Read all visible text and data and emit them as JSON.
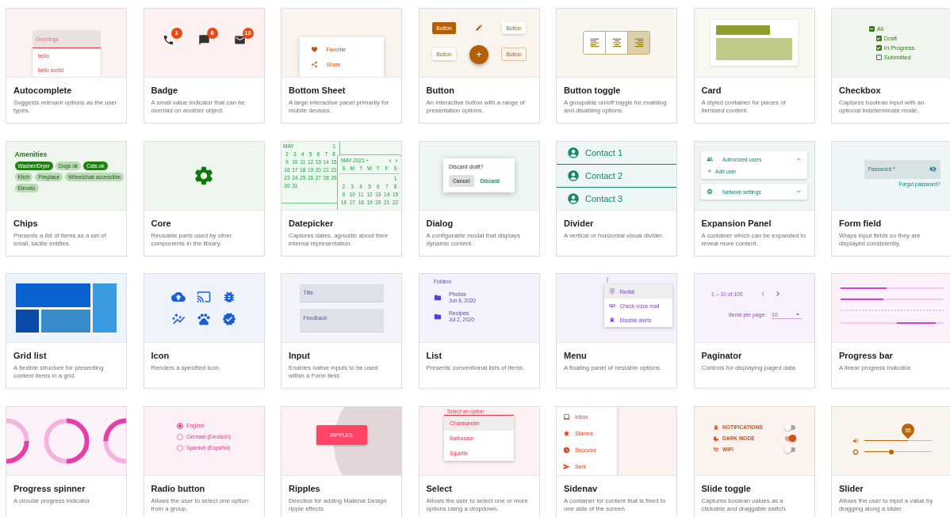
{
  "cards": [
    {
      "title": "Autocomplete",
      "description": "Suggests relevant options as the user types.",
      "preview": {
        "kind": "autocomplete",
        "placeholder": "Greetings",
        "options": [
          "hello",
          "hello world"
        ]
      }
    },
    {
      "title": "Badge",
      "description": "A small value indicator that can be overlaid on another object.",
      "preview": {
        "kind": "badge",
        "counts": [
          "1",
          "6",
          "18"
        ]
      }
    },
    {
      "title": "Bottom Sheet",
      "description": "A large interactive panel primarily for mobile devices.",
      "preview": {
        "kind": "bottom-sheet",
        "items": [
          "Favorite",
          "Share"
        ]
      }
    },
    {
      "title": "Button",
      "description": "An interactive button with a range of presentation options.",
      "preview": {
        "kind": "buttons",
        "buttons": [
          {
            "kind": "flat",
            "label": "Button"
          },
          {
            "kind": "icon"
          },
          {
            "kind": "raised",
            "label": "Button"
          },
          {
            "kind": "raised",
            "label": "Button"
          },
          {
            "kind": "fab",
            "label": "+"
          },
          {
            "kind": "stroked",
            "label": "Button"
          }
        ]
      }
    },
    {
      "title": "Button toggle",
      "description": "A groupable on/off toggle for enabling and disabling options.",
      "preview": {
        "kind": "button-toggle",
        "toggles": [
          {
            "selected": false
          },
          {
            "selected": false
          },
          {
            "selected": true
          }
        ]
      }
    },
    {
      "title": "Card",
      "description": "A styled container for pieces of itemized content.",
      "preview": {
        "kind": "card"
      }
    },
    {
      "title": "Checkbox",
      "description": "Captures boolean input with an optional indeterminate mode.",
      "preview": {
        "kind": "checkbox",
        "items": [
          {
            "label": "All",
            "indeterminate": true,
            "children": [
              {
                "label": "Draft",
                "checked": true
              },
              {
                "label": "In Progress",
                "checked": true
              },
              {
                "label": "Submitted",
                "checked": false
              }
            ]
          }
        ]
      }
    },
    {
      "title": "Chips",
      "description": "Presents a list of items as a set of small, tactile entities.",
      "preview": {
        "kind": "chips",
        "title": "Amenities",
        "chips": [
          {
            "label": "Washer/Dryer",
            "selected": true
          },
          {
            "label": "Dogs ok",
            "selected": false
          },
          {
            "label": "Cats ok",
            "selected": true
          },
          {
            "label": "Kitch",
            "selected": false
          },
          {
            "label": "Fireplace",
            "selected": false
          },
          {
            "label": "Wheelchair accessible",
            "selected": false
          },
          {
            "label": "Elevato",
            "selected": false
          }
        ]
      }
    },
    {
      "title": "Core",
      "description": "Reusable parts used by other components in the library.",
      "preview": {
        "kind": "core"
      }
    },
    {
      "title": "Datepicker",
      "description": "Captures dates, agnostic about their internal representation.",
      "preview": {
        "kind": "datepicker",
        "left": {
          "month": "MAY",
          "weeks": [
            [
              "1"
            ],
            [
              "2",
              "3",
              "4",
              "5",
              "6",
              "7",
              "8"
            ],
            [
              "9",
              "10",
              "11",
              "12",
              "13",
              "14",
              "15"
            ],
            [
              "16",
              "17",
              "18",
              "19",
              "20",
              "21",
              "22"
            ],
            [
              "23",
              "24",
              "25",
              "26",
              "27",
              "28",
              "29"
            ],
            [
              "30",
              "31"
            ]
          ]
        },
        "right": {
          "header": "MAY 2021",
          "weekdays": [
            "S",
            "M",
            "T",
            "W",
            "T",
            "F",
            "S"
          ],
          "weeks": [
            [
              "1"
            ],
            [
              "2",
              "3",
              "4",
              "5",
              "6",
              "7",
              "8"
            ],
            [
              "9",
              "10",
              "11",
              "12",
              "13",
              "14",
              "15"
            ],
            [
              "16",
              "17",
              "18",
              "19",
              "20",
              "21",
              "22"
            ]
          ]
        }
      }
    },
    {
      "title": "Dialog",
      "description": "A configurable modal that displays dynamic content.",
      "preview": {
        "kind": "dialog",
        "message": "Discard draft?",
        "actions": [
          {
            "label": "Cancel",
            "selected": true
          },
          {
            "label": "Discard",
            "selected": false
          }
        ]
      }
    },
    {
      "title": "Divider",
      "description": "A vertical or horizontal visual divider.",
      "preview": {
        "kind": "divider",
        "items": [
          "Contact 1",
          "Contact 2",
          "Contact 3"
        ]
      }
    },
    {
      "title": "Expansion Panel",
      "description": "A container which can be expanded to reveal more content.",
      "preview": {
        "kind": "expansion",
        "panels": [
          {
            "title": "Authorized users",
            "expanded": true,
            "actions": [
              "Add user"
            ]
          },
          {
            "title": "Network settings",
            "expanded": false
          }
        ]
      }
    },
    {
      "title": "Form field",
      "description": "Wraps input fields so they are displayed consistently.",
      "preview": {
        "kind": "form-field",
        "placeholder": "Password *",
        "hint": "Forgot password?"
      }
    },
    {
      "title": "Grid list",
      "description": "A flexible structure for presenting content items in a grid.",
      "preview": {
        "kind": "grid-list"
      }
    },
    {
      "title": "Icon",
      "description": "Renders a specified icon.",
      "preview": {
        "kind": "icons"
      }
    },
    {
      "title": "Input",
      "description": "Enables native inputs to be used within a Form field.",
      "preview": {
        "kind": "input",
        "fields": [
          {
            "placeholder": "Title"
          },
          {
            "placeholder": "Feedback"
          }
        ]
      }
    },
    {
      "title": "List",
      "description": "Presents conventional lists of items.",
      "preview": {
        "kind": "list",
        "heading": "Folders",
        "items": [
          {
            "name": "Photos",
            "date": "Jun 8, 2020"
          },
          {
            "name": "Recipes",
            "date": "Jul 2, 2020"
          }
        ]
      }
    },
    {
      "title": "Menu",
      "description": "A floating panel of nestable options.",
      "preview": {
        "kind": "menu",
        "items": [
          {
            "label": "Redial",
            "selected": true
          },
          {
            "label": "Check voice mail",
            "selected": false
          },
          {
            "label": "Disable alerts",
            "selected": false
          }
        ]
      }
    },
    {
      "title": "Paginator",
      "description": "Controls for displaying paged data.",
      "preview": {
        "kind": "paginator",
        "range": "1 – 10 of 100",
        "page_size_label": "Items per page:",
        "page_size": "10"
      }
    },
    {
      "title": "Progress bar",
      "description": "A linear progress indicator.",
      "preview": {
        "kind": "progress-bar",
        "bars": [
          {
            "kind": "determinate",
            "level": 0.45
          },
          {
            "kind": "determinate",
            "level": 0.42
          },
          {
            "kind": "buffer"
          },
          {
            "kind": "query"
          }
        ]
      }
    },
    {
      "title": "Progress spinner",
      "description": "A circular progress indicator.",
      "preview": {
        "kind": "progress-spinner"
      }
    },
    {
      "title": "Radio button",
      "description": "Allows the user to select one option from a group.",
      "preview": {
        "kind": "radio",
        "options": [
          {
            "label": "English",
            "selected": true
          },
          {
            "label": "German (Deutsch)",
            "selected": false
          },
          {
            "label": "Spanish (Español)",
            "selected": false
          }
        ]
      }
    },
    {
      "title": "Ripples",
      "description": "Directive for adding Material Design ripple effects",
      "preview": {
        "kind": "ripples",
        "label": "RIPPLES"
      }
    },
    {
      "title": "Select",
      "description": "Allows the user to select one or more options using a dropdown.",
      "preview": {
        "kind": "select",
        "label": "Select an option",
        "options": [
          {
            "label": "Charmander",
            "selected": true
          },
          {
            "label": "Bulbasaur",
            "selected": false
          },
          {
            "label": "Squirtle",
            "selected": false
          }
        ]
      }
    },
    {
      "title": "Sidenav",
      "description": "A container for content that is fixed to one side of the screen.",
      "preview": {
        "kind": "sidenav",
        "items": [
          "Inbox",
          "Starred",
          "Snoozed",
          "Sent"
        ]
      }
    },
    {
      "title": "Slide toggle",
      "description": "Captures boolean values as a clickable and draggable switch.",
      "preview": {
        "kind": "slide-toggle",
        "toggles": [
          {
            "label": "NOTIFICATIONS",
            "on": false
          },
          {
            "label": "DARK MODE",
            "on": true
          },
          {
            "label": "WiFi",
            "on": false
          }
        ]
      }
    },
    {
      "title": "Slider",
      "description": "Allows the user to input a value by dragging along a slider.",
      "preview": {
        "kind": "slider",
        "sliders": [
          {
            "level": 0.65,
            "thumb_label": "65"
          },
          {
            "level": 0.4
          }
        ]
      }
    }
  ]
}
